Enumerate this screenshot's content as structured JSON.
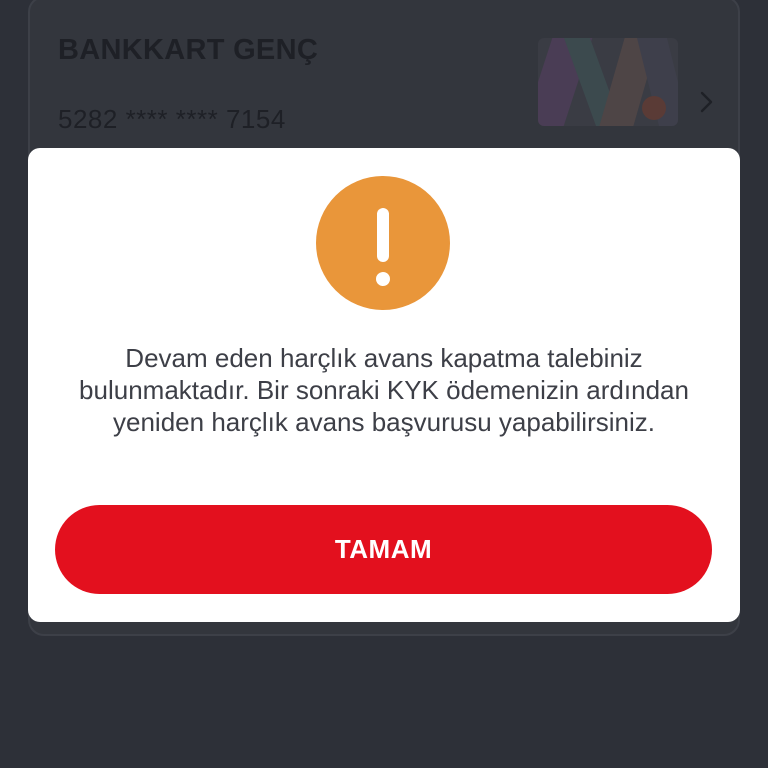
{
  "card": {
    "title": "BANKKART GENÇ",
    "number": "5282 **** **** 7154",
    "chevron_icon": "chevron-right-icon"
  },
  "dialog": {
    "icon": "warning-exclamation-icon",
    "icon_color": "#e9963a",
    "message": "Devam eden harçlık avans kapatma talebiniz bulunmaktadır. Bir sonraki KYK ödemenizin ardından yeniden harçlık avans başvurusu yapabilirsiniz.",
    "button_label": "TAMAM",
    "button_color": "#e3101e"
  }
}
